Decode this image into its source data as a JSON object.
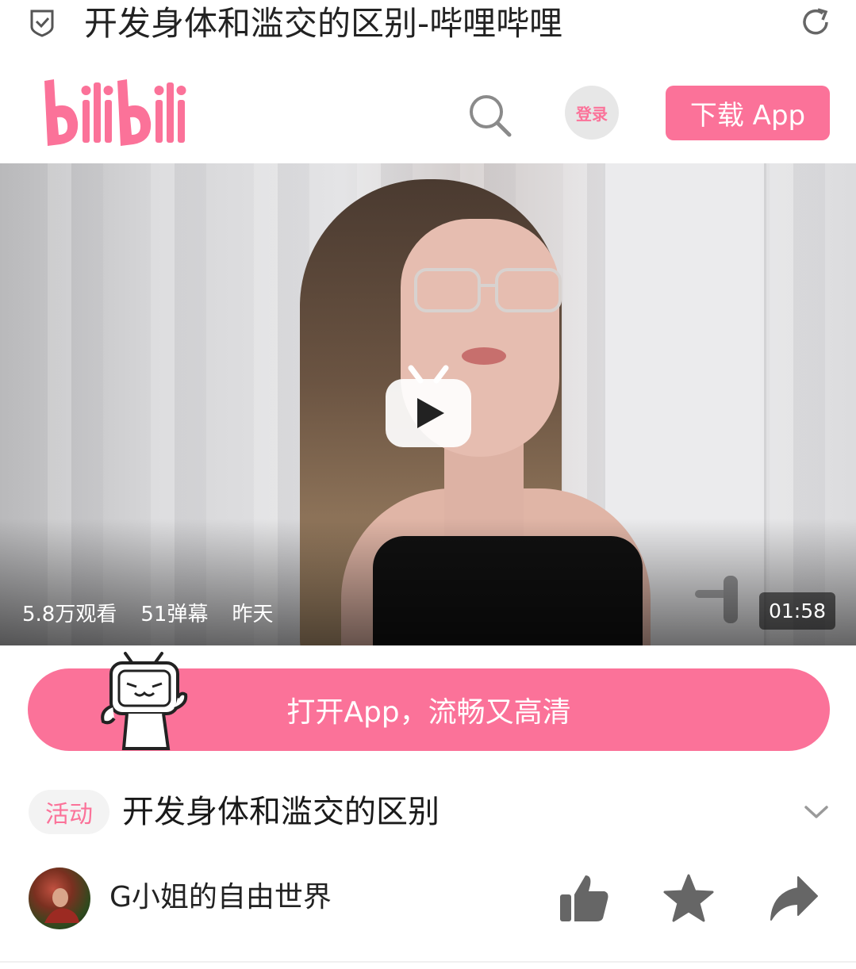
{
  "browser": {
    "title": "开发身体和滥交的区别-哔哩哔哩"
  },
  "header": {
    "logo_text": "bilibili",
    "login_label": "登录",
    "download_label": "下载 App"
  },
  "video": {
    "views": "5.8万观看",
    "danmaku": "51弹幕",
    "date": "昨天",
    "duration": "01:58"
  },
  "banner": {
    "label": "打开App，流畅又高清"
  },
  "info": {
    "tag": "活动",
    "title": "开发身体和滥交的区别"
  },
  "author": {
    "name": "G小姐的自由世界"
  },
  "colors": {
    "brand_pink": "#fb7299"
  }
}
